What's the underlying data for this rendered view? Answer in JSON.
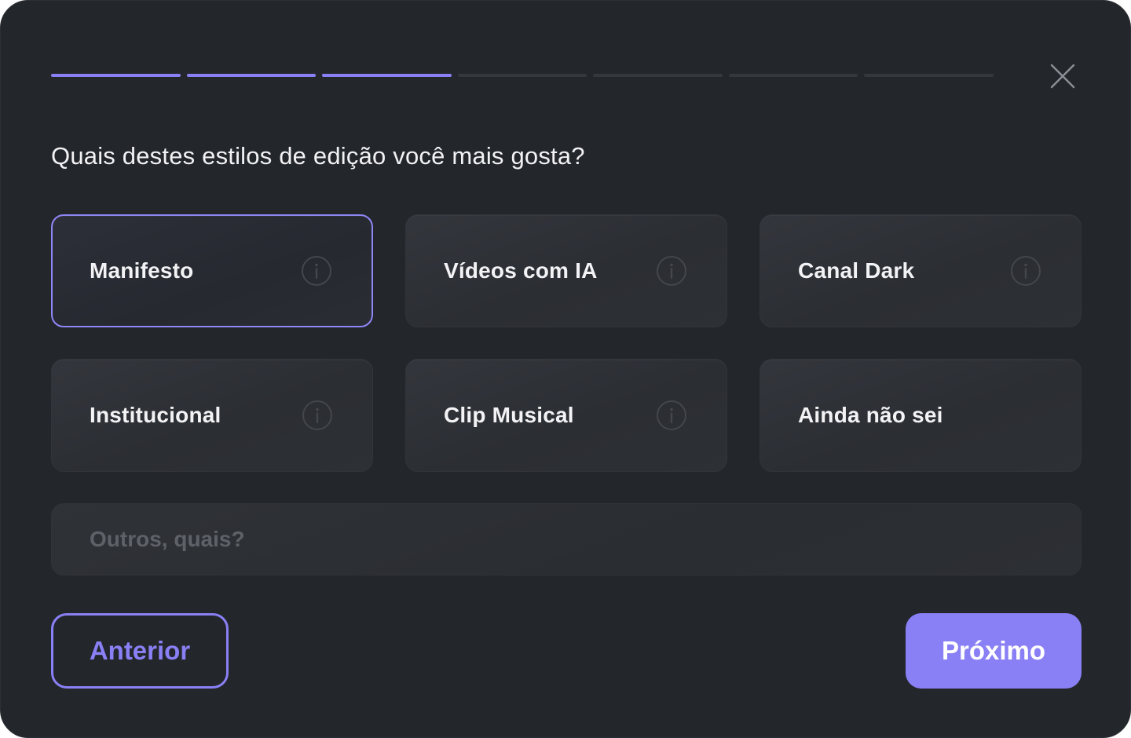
{
  "progress": {
    "total_steps": 7,
    "completed_steps": 3,
    "accent_color": "#8a80f5"
  },
  "close_icon": "close-icon",
  "question": "Quais destes estilos de edição você mais gosta?",
  "options": [
    {
      "label": "Manifesto",
      "selected": true,
      "has_info": true
    },
    {
      "label": "Vídeos com IA",
      "selected": false,
      "has_info": true
    },
    {
      "label": "Canal Dark",
      "selected": false,
      "has_info": true
    },
    {
      "label": "Institucional",
      "selected": false,
      "has_info": true
    },
    {
      "label": "Clip Musical",
      "selected": false,
      "has_info": true
    },
    {
      "label": "Ainda não sei",
      "selected": false,
      "has_info": false
    }
  ],
  "other_input": {
    "placeholder": "Outros, quais?",
    "value": ""
  },
  "buttons": {
    "prev_label": "Anterior",
    "next_label": "Próximo"
  }
}
